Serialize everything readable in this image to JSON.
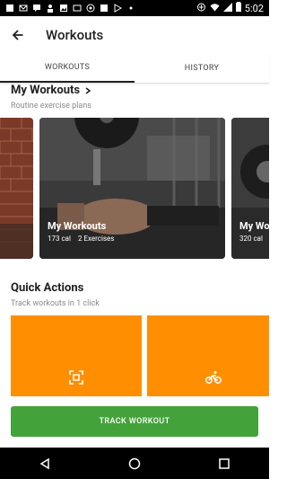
{
  "status_bar": {
    "time": "5:02"
  },
  "header": {
    "title": "Workouts"
  },
  "tabs": [
    {
      "label": "WORKOUTS"
    },
    {
      "label": "HISTORY"
    }
  ],
  "my_workouts": {
    "title": "My Workouts",
    "subtitle": "Routine exercise plans",
    "cards": [
      {
        "title": "My Workouts",
        "calories": "173 cal",
        "exercises": "2 Exercises"
      },
      {
        "title": "My Wo",
        "calories": "320 cal",
        "exercises": ""
      }
    ]
  },
  "quick_actions": {
    "title": "Quick Actions",
    "subtitle": "Track workouts in 1 click"
  },
  "track_button": {
    "label": "TRACK WORKOUT"
  },
  "colors": {
    "accent_orange": "#ff8f00",
    "accent_green": "#43a33a"
  }
}
